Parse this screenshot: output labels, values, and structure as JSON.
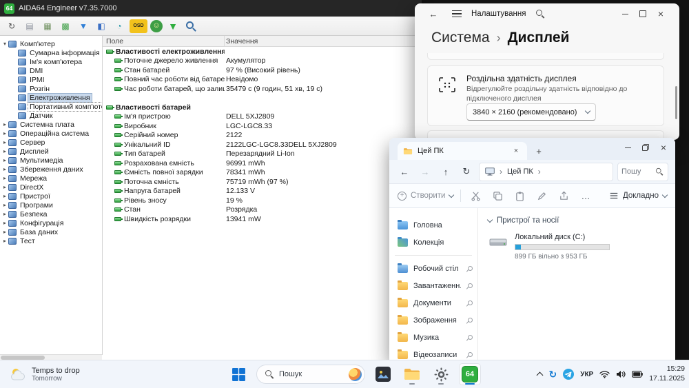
{
  "aida": {
    "app_icon": "64",
    "title": "AIDA64 Engineer v7.35.7000",
    "toolbar": [
      {
        "name": "refresh-icon",
        "glyph": "↻",
        "color": "#4a4a4a"
      },
      {
        "name": "report-icon",
        "glyph": "▤",
        "color": "#8a8f9a"
      },
      {
        "name": "video-card-icon",
        "glyph": "▦",
        "color": "#6e8f5e"
      },
      {
        "name": "chip-icon",
        "glyph": "▩",
        "color": "#3d9e45"
      },
      {
        "name": "driver-update-icon",
        "glyph": "▼",
        "color": "#2f7fd6"
      },
      {
        "name": "monitor-diag-icon",
        "glyph": "◧",
        "color": "#3b6fc4"
      },
      {
        "name": "benchmark-icon",
        "glyph": "◔",
        "color": "#2f9aa8"
      },
      {
        "name": "osd-badge",
        "glyph": "OSD",
        "color": "#222222",
        "bg": "#f2c21c"
      },
      {
        "name": "sensorpanel-icon",
        "glyph": "☺",
        "color": "#fff2a8",
        "bg": "#3d9e45"
      },
      {
        "name": "download-icon",
        "glyph": "▼",
        "color": "#2fae3f"
      },
      {
        "name": "find-icon",
        "glyph": "",
        "color": "#3a6ea5"
      }
    ],
    "tree": [
      {
        "label": "Комп'ютер",
        "level": 0,
        "expanded": true
      },
      {
        "label": "Сумарна інформація",
        "level": 1
      },
      {
        "label": "Ім'я комп'ютера",
        "level": 1
      },
      {
        "label": "DMI",
        "level": 1
      },
      {
        "label": "IPMI",
        "level": 1
      },
      {
        "label": "Розгін",
        "level": 1
      },
      {
        "label": "Електроживлення",
        "level": 1,
        "selected": true
      },
      {
        "label": "Портативний комп'ютер",
        "level": 1,
        "focused": true
      },
      {
        "label": "Датчик",
        "level": 1
      },
      {
        "label": "Системна плата",
        "level": 0,
        "expanded": false
      },
      {
        "label": "Операційна система",
        "level": 0,
        "expanded": false
      },
      {
        "label": "Сервер",
        "level": 0,
        "expanded": false
      },
      {
        "label": "Дисплей",
        "level": 0,
        "expanded": false
      },
      {
        "label": "Мультимедіа",
        "level": 0,
        "expanded": false
      },
      {
        "label": "Збереження даних",
        "level": 0,
        "expanded": false
      },
      {
        "label": "Мережа",
        "level": 0,
        "expanded": false
      },
      {
        "label": "DirectX",
        "level": 0,
        "expanded": false
      },
      {
        "label": "Пристрої",
        "level": 0,
        "expanded": false
      },
      {
        "label": "Програми",
        "level": 0,
        "expanded": false
      },
      {
        "label": "Безпека",
        "level": 0,
        "expanded": false
      },
      {
        "label": "Конфігурація",
        "level": 0,
        "expanded": false
      },
      {
        "label": "База даних",
        "level": 0,
        "expanded": false
      },
      {
        "label": "Тест",
        "level": 0,
        "expanded": false
      }
    ],
    "table": {
      "columns": [
        "Поле",
        "Значення"
      ],
      "rows": [
        {
          "type": "section",
          "field": "Властивості електроживлення",
          "value": ""
        },
        {
          "type": "child",
          "field": "Поточне джерело живлення",
          "value": "Акумулятор"
        },
        {
          "type": "child",
          "field": "Стан батарей",
          "value": "97 % (Високий рівень)"
        },
        {
          "type": "child",
          "field": "Повний час роботи від батарей",
          "value": "Невідомо"
        },
        {
          "type": "child",
          "field": "Час роботи батарей, що залиши...",
          "value": "35479 с (9 годин, 51 хв, 19 с)"
        },
        {
          "type": "spacer",
          "field": "",
          "value": ""
        },
        {
          "type": "section",
          "field": "Властивості батарей",
          "value": ""
        },
        {
          "type": "child",
          "field": "Ім'я пристрою",
          "value": "DELL 5XJ2809"
        },
        {
          "type": "child",
          "field": "Виробник",
          "value": "LGC-LGC8.33"
        },
        {
          "type": "child",
          "field": "Серійний номер",
          "value": "2122"
        },
        {
          "type": "child",
          "field": "Унікальний ID",
          "value": "2122LGC-LGC8.33DELL 5XJ2809"
        },
        {
          "type": "child",
          "field": "Тип батарей",
          "value": "Перезарядний Li-Ion"
        },
        {
          "type": "child",
          "field": "Розрахована ємність",
          "value": "96991 mWh"
        },
        {
          "type": "child",
          "field": "Ємність повної зарядки",
          "value": "78341 mWh"
        },
        {
          "type": "child",
          "field": "Поточна ємність",
          "value": "75719 mWh  (97 %)"
        },
        {
          "type": "child",
          "field": "Напруга батарей",
          "value": "12.133 V"
        },
        {
          "type": "child",
          "field": "Рівень зносу",
          "value": "19 %"
        },
        {
          "type": "child",
          "field": "Стан",
          "value": "Розрядка"
        },
        {
          "type": "child",
          "field": "Швидкість розрядки",
          "value": "13941 mW"
        }
      ]
    }
  },
  "settings": {
    "title": "Налаштування",
    "breadcrumb": {
      "parent": "Система",
      "separator": "›",
      "current": "Дисплей"
    },
    "card": {
      "title": "Роздільна здатність дисплея",
      "subtitle": "Відрегулюйте роздільну здатність відповідно до підключеного дисплея",
      "dropdown_value": "3840 × 2160 (рекомендовано)"
    }
  },
  "explorer": {
    "tab_label": "Цей ПК",
    "address": "Цей ПК",
    "search_text": "Пошу",
    "commands": {
      "new_label": "Створити",
      "more": "…",
      "details_label": "Докладно"
    },
    "sidebar": [
      {
        "label": "Головна",
        "icon": "home"
      },
      {
        "label": "Колекція",
        "icon": "gallery"
      },
      {
        "type": "divider"
      },
      {
        "label": "Робочий стіл",
        "icon": "desktop",
        "pinned": true
      },
      {
        "label": "Завантаженн...",
        "icon": "downloads",
        "pinned": true
      },
      {
        "label": "Документи",
        "icon": "documents",
        "pinned": true
      },
      {
        "label": "Зображення",
        "icon": "pictures",
        "pinned": true
      },
      {
        "label": "Музика",
        "icon": "music",
        "pinned": true
      },
      {
        "label": "Відеозаписи",
        "icon": "videos",
        "pinned": true
      }
    ],
    "group_label": "Пристрої та носії",
    "drive": {
      "name": "Локальний диск (C:)",
      "caption": "899 ГБ вільно з 953 ГБ",
      "used_percent": 6
    }
  },
  "taskbar": {
    "weather": {
      "line1": "Temps to drop",
      "line2": "Tomorrow"
    },
    "search_label": "Пошук",
    "language": "УКР",
    "clock": {
      "time": "15:29",
      "date": "17.11.2025"
    }
  }
}
